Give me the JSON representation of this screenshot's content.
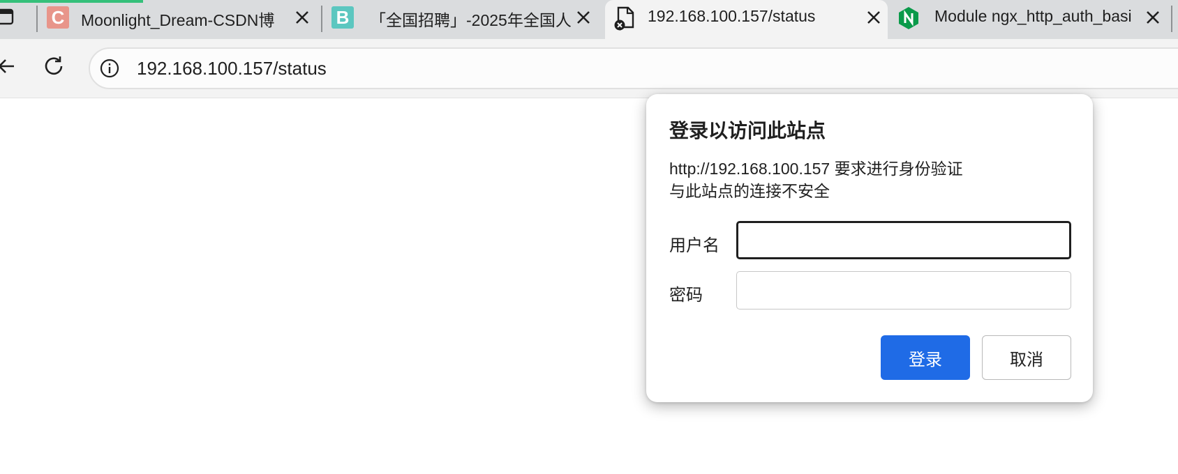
{
  "tabs": [
    {
      "title": "Moonlight_Dream-CSDN博",
      "favicon": "csdn-icon",
      "favicon_letter": "C",
      "favicon_color": "#e8958a"
    },
    {
      "title": "「全国招聘」-2025年全国人",
      "favicon": "boss-icon",
      "favicon_letter": "B",
      "favicon_color": "#5cc7c0"
    },
    {
      "title": "192.168.100.157/status",
      "favicon": "broken-page-icon",
      "active": true
    },
    {
      "title": "Module ngx_http_auth_basic",
      "favicon": "nginx-icon",
      "favicon_letter": "N",
      "favicon_color": "#0a9a4a"
    }
  ],
  "toolbar": {
    "url": "192.168.100.157/status"
  },
  "dialog": {
    "heading": "登录以访问此站点",
    "message_line1": "http://192.168.100.157 要求进行身份验证",
    "message_line2": "与此站点的连接不安全",
    "username_label": "用户名",
    "username_value": "",
    "password_label": "密码",
    "password_value": "",
    "login_button": "登录",
    "cancel_button": "取消"
  },
  "colors": {
    "loading_bar": "#35c07a",
    "primary_button": "#1f6be6"
  }
}
